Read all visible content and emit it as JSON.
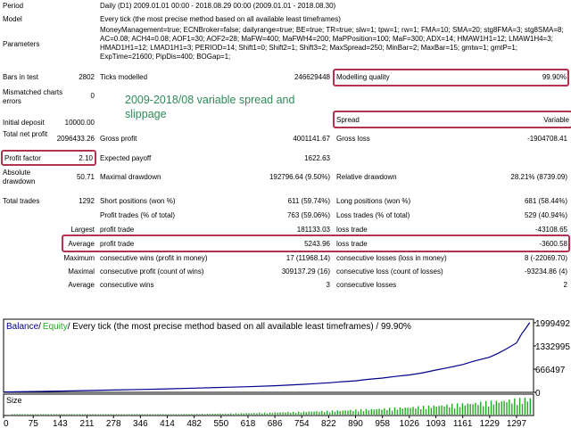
{
  "report": {
    "period_label": "Period",
    "period_value": "Daily (D1) 2009.01.01 00:00 - 2018.08.29 00:00 (2009.01.01 - 2018.08.30)",
    "model_label": "Model",
    "model_value": "Every tick (the most precise method based on all available least timeframes)",
    "parameters_label": "Parameters",
    "parameters_value": "MoneyManagement=true; ECNBroker=false; dailyrange=true; BE=true; TR=true; slw=1; tpw=1; rw=1; FMA=10; SMA=20; stg8FMA=3; stg8SMA=8; AC=0.08; ACH4=0.08; AOF1=30; AOF2=28; MaFW=400; MaFWH4=200; MaPPosition=100; MaF=300; ADX=14; HMAW1H1=12; LMAW1H4=3; HMAD1H1=12; LMAD1H1=3; PERIOD=14; Shift1=0; Shift2=1; Shift3=2; MaxSpread=250; MinBar=2; MaxBar=15; gmtw=1; gmtP=1; ExpTime=21600; PipDis=400; BOGap=1;",
    "bars_label": "Bars in test",
    "bars_value": "2802",
    "ticks_label": "Ticks modelled",
    "ticks_value": "246629448",
    "mq_label": "Modelling quality",
    "mq_value": "99.90%",
    "mismatch_label": "Mismatched charts errors",
    "mismatch_value": "0",
    "initdep_label": "Initial deposit",
    "initdep_value": "10000.00",
    "spread_label": "Spread",
    "spread_value": "Variable",
    "tnp_label": "Total net profit",
    "tnp_value": "2096433.26",
    "gp_label": "Gross profit",
    "gp_value": "4001141.67",
    "gl_label": "Gross loss",
    "gl_value": "-1904708.41",
    "pf_label": "Profit factor",
    "pf_value": "2.10",
    "ep_label": "Expected payoff",
    "ep_value": "1622.63",
    "absdd_label": "Absolute drawdown",
    "absdd_value": "50.71",
    "maxdd_label": "Maximal drawdown",
    "maxdd_value": "192796.64 (9.50%)",
    "reldd_label": "Relative drawdown",
    "reldd_value": "28.21% (8739.09)",
    "tt_label": "Total trades",
    "tt_value": "1292",
    "sp_label": "Short positions (won %)",
    "sp_value": "611 (59.74%)",
    "lp_label": "Long positions (won %)",
    "lp_value": "681 (58.44%)",
    "pt_label": "Profit trades (% of total)",
    "pt_value": "763 (59.06%)",
    "lt_label": "Loss trades (% of total)",
    "lt_value": "529 (40.94%)",
    "largest_label": "Largest",
    "largest_profit_label": "profit trade",
    "largest_profit_value": "181133.03",
    "largest_loss_label": "loss trade",
    "largest_loss_value": "-43108.65",
    "average_label": "Average",
    "avg_profit_label": "profit trade",
    "avg_profit_value": "5243.96",
    "avg_loss_label": "loss trade",
    "avg_loss_value": "-3600.58",
    "maximum_label": "Maximum",
    "max_cw_label": "consecutive wins (profit in money)",
    "max_cw_value": "17 (11968.14)",
    "max_cl_label": "consecutive losses (loss in money)",
    "max_cl_value": "8 (-22069.70)",
    "maximal_label": "Maximal",
    "mxl_cp_label": "consecutive profit (count of wins)",
    "mxl_cp_value": "309137.29 (16)",
    "mxl_cl_label": "consecutive loss (count of losses)",
    "mxl_cl_value": "-93234.86 (4)",
    "avg2_label": "Average",
    "avg_cw_label": "consecutive wins",
    "avg_cw_value": "3",
    "avg_cl_label": "consecutive losses",
    "avg_cl_value": "2"
  },
  "annotation": {
    "line1": "2009-2018/08 variable spread and",
    "line2": "slippage"
  },
  "legend": {
    "balance": "Balance",
    "sep": " / ",
    "equity": "Equity",
    "rest": " / Every tick (the most precise method based on all available least timeframes) / 99.90%"
  },
  "size_label": "Size",
  "colors": {
    "balance": "#00008b",
    "equity": "#22aa22",
    "highlight": "#b0344f",
    "annotation": "#2e8b57"
  },
  "chart_data": {
    "type": "line",
    "title": "Balance / Equity / Every tick (the most precise method based on all available least timeframes) / 99.90%",
    "xlabel": "",
    "ylabel": "",
    "x_ticks": [
      0,
      75,
      143,
      211,
      278,
      346,
      414,
      482,
      550,
      618,
      686,
      754,
      822,
      890,
      958,
      1026,
      1093,
      1161,
      1229,
      1297
    ],
    "y_ticks": [
      0,
      666497,
      1332995,
      1999492
    ],
    "xlim": [
      0,
      1340
    ],
    "ylim": [
      0,
      2100000
    ],
    "series": [
      {
        "name": "Balance",
        "x": [
          0,
          75,
          143,
          211,
          278,
          346,
          414,
          482,
          550,
          618,
          686,
          754,
          790,
          822,
          850,
          890,
          920,
          958,
          990,
          1026,
          1060,
          1093,
          1120,
          1161,
          1190,
          1229,
          1250,
          1270,
          1297,
          1310,
          1320,
          1330
        ],
        "values": [
          10000,
          22000,
          35000,
          50000,
          66000,
          82000,
          100000,
          120000,
          140000,
          162000,
          190000,
          228000,
          250000,
          275000,
          300000,
          330000,
          372000,
          410000,
          455000,
          500000,
          560000,
          640000,
          700000,
          800000,
          900000,
          1010000,
          1120000,
          1240000,
          1420000,
          1680000,
          1830000,
          2000000
        ]
      }
    ],
    "size_histogram": {
      "name": "Size",
      "note": "lot size bars per trade, growing toward the end"
    }
  }
}
